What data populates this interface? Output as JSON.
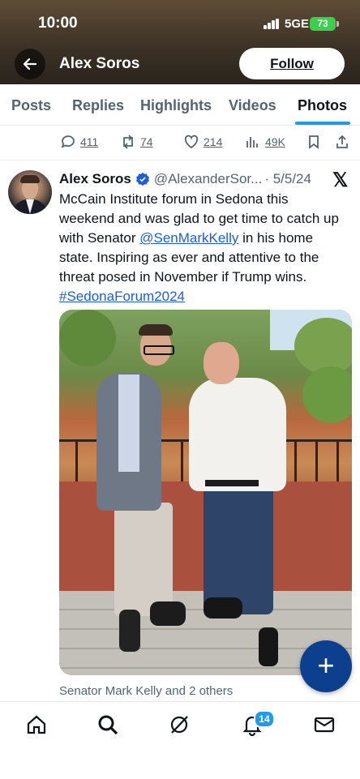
{
  "status_bar": {
    "time": "10:00",
    "network": "5GE",
    "battery": "73"
  },
  "header": {
    "title": "Alex Soros",
    "follow_label": "Follow"
  },
  "tabs": [
    {
      "label": "Posts"
    },
    {
      "label": "Replies"
    },
    {
      "label": "Highlights"
    },
    {
      "label": "Videos"
    },
    {
      "label": "Photos",
      "active": true
    }
  ],
  "prev_post_actions": {
    "replies": "411",
    "reposts": "74",
    "likes": "214",
    "views": "49K"
  },
  "tweet": {
    "author": "Alex Soros",
    "handle": "@AlexanderSor...",
    "date": "· 5/5/24",
    "text_part1": "McCain Institute forum in Sedona this weekend and was glad to get time to catch up with Senator ",
    "mention": "@SenMarkKelly",
    "text_part2": " in his home state. Inspiring as ever and attentive to the threat posed in November if Trump wins. ",
    "hashtag": "#SedonaForum2024",
    "photo_tags": "Senator Mark Kelly and 2 others"
  },
  "fab": {
    "label": "+"
  },
  "nav": {
    "notifications_badge": "14"
  },
  "colors": {
    "accent": "#1d9bf0",
    "fab": "#0d3f8f",
    "link": "#1d5ed8",
    "verified": "#1d9bf0"
  }
}
